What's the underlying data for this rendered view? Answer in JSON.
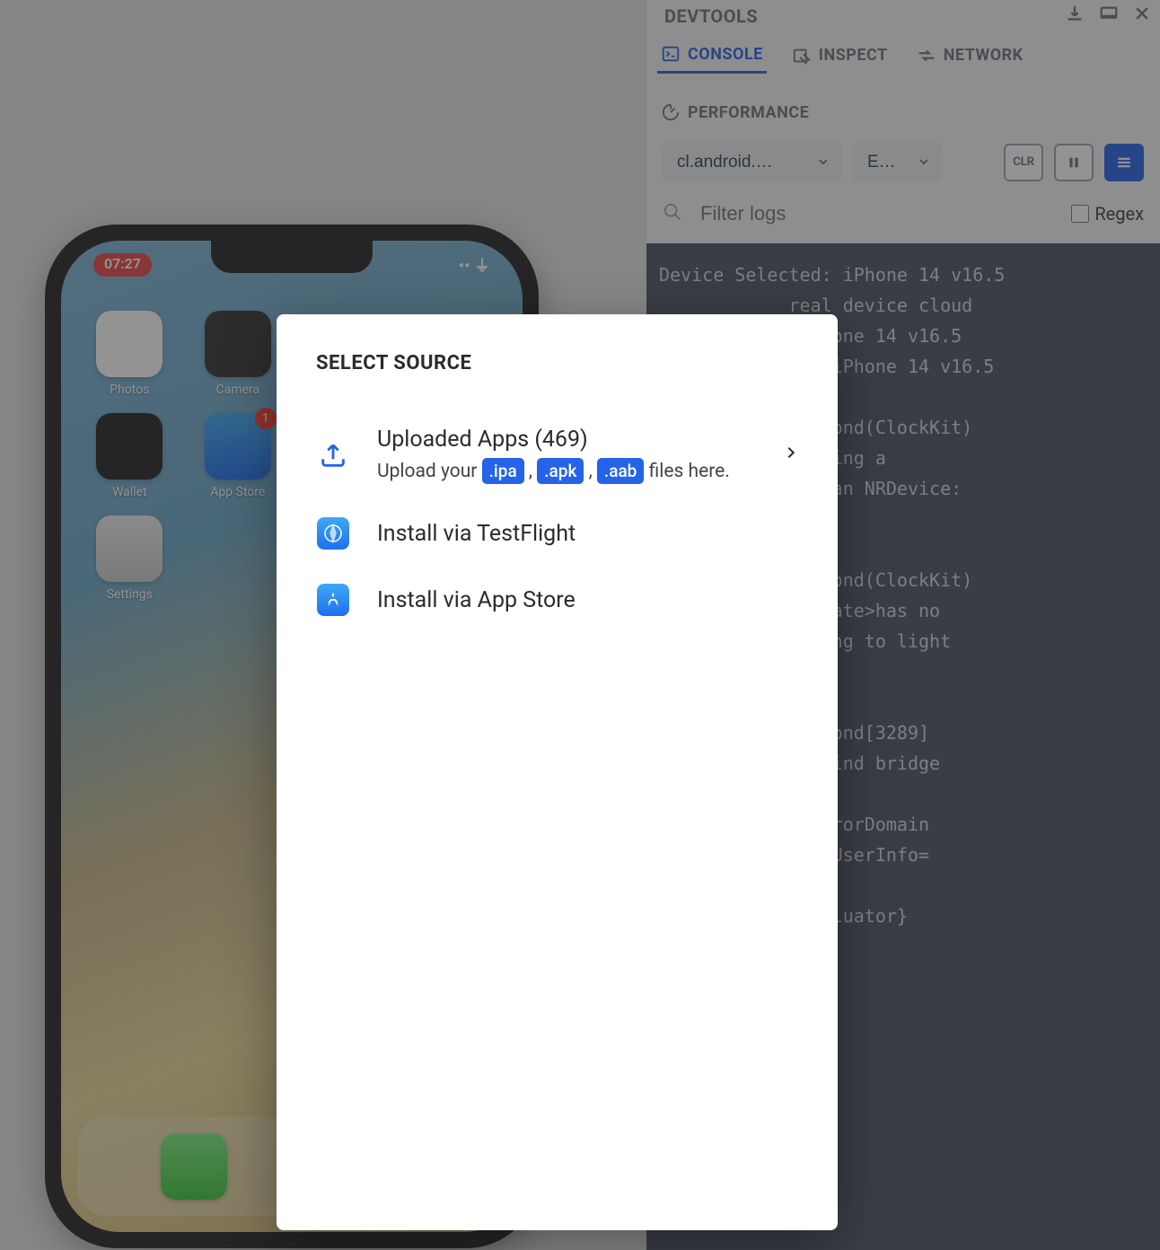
{
  "phone": {
    "time": "07:27",
    "apps": [
      {
        "label": "Photos"
      },
      {
        "label": "Camera"
      },
      {
        "label": "Wallet"
      },
      {
        "label": "App Store",
        "badge": "1"
      },
      {
        "label": "Settings"
      }
    ]
  },
  "devtools": {
    "title": "DEVTOOLS",
    "tabs": {
      "console": "CONSOLE",
      "inspect": "INSPECT",
      "network": "NETWORK",
      "performance": "PERFORMANCE"
    },
    "select1": "cl.android.…",
    "select2": "E…",
    "clr_btn": "CLR",
    "filter_placeholder": "Filter logs",
    "regex_label": "Regex",
    "log": "Device Selected: iPhone 14 v16.5\n            real device cloud\n          ce iPhone 14 v16.5\n           p on iPhone 14 v16.5\n       5:39\n         companiond(ClockKit)\n       r>: Creating a\n         ithout an NRDevice:\n\n       5:39\n         companiond(ClockKit)\n       r>: <private>has no\n         efaulting to light\n\n       5:39\n         companiond[3289]\n        uldn't find bridge\n       ror\n        StatusErrorDomain\n       \"(null)\" UserInfo=\n       59,\n        rerunEvaluator}"
  },
  "modal": {
    "title": "SELECT SOURCE",
    "uploaded_label": "Uploaded Apps (469)",
    "upload_prefix": "Upload your ",
    "tag_ipa": ".ipa",
    "tag_apk": ".apk",
    "tag_aab": ".aab",
    "upload_suffix": " files here.",
    "comma": " , ",
    "testflight_label": "Install via TestFlight",
    "appstore_label": "Install via App Store"
  }
}
